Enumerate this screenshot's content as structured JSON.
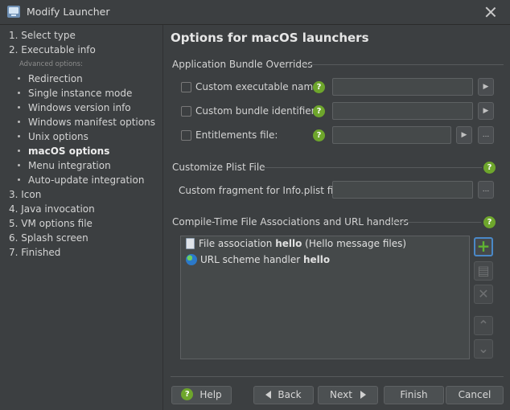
{
  "window": {
    "title": "Modify Launcher",
    "app_icon": "monitor-icon",
    "close_icon": "close-icon"
  },
  "sidebar": {
    "steps": [
      {
        "label": "1. Select type"
      },
      {
        "label": "2. Executable info"
      },
      {
        "label": "3. Icon"
      },
      {
        "label": "4. Java invocation"
      },
      {
        "label": "5. VM options file"
      },
      {
        "label": "6. Splash screen"
      },
      {
        "label": "7. Finished"
      }
    ],
    "advanced_label": "Advanced options:",
    "sub_steps": [
      {
        "label": "Redirection"
      },
      {
        "label": "Single instance mode"
      },
      {
        "label": "Windows version info"
      },
      {
        "label": "Windows manifest options"
      },
      {
        "label": "Unix options"
      },
      {
        "label": "macOS options",
        "active": true
      },
      {
        "label": "Menu integration"
      },
      {
        "label": "Auto-update integration"
      }
    ]
  },
  "main": {
    "page_title": "Options for macOS launchers",
    "bundle_overrides": {
      "title": "Application Bundle Overrides",
      "fields": [
        {
          "label": "Custom executable name:",
          "value": "",
          "checked": false
        },
        {
          "label": "Custom bundle identifier:",
          "value": "",
          "checked": false
        },
        {
          "label": "Entitlements file:",
          "value": "",
          "checked": false
        }
      ]
    },
    "plist": {
      "title": "Customize Plist File",
      "label": "Custom fragment for Info.plist file:",
      "value": "",
      "browse_label": "..."
    },
    "associations": {
      "title": "Compile-Time File Associations and URL handlers",
      "items": [
        {
          "icon": "file-icon",
          "prefix": "File association ",
          "bold": "hello",
          "suffix": " (Hello message files)"
        },
        {
          "icon": "globe-icon",
          "prefix": "URL scheme handler ",
          "bold": "hello",
          "suffix": ""
        }
      ],
      "tools": [
        "add-icon",
        "edit-icon",
        "delete-icon",
        "move-up-icon",
        "move-down-icon"
      ]
    },
    "help_glyph": "?",
    "browse_glyph": "...",
    "arrow_glyph": "▶"
  },
  "footer": {
    "help": "Help",
    "back": "Back",
    "next": "Next",
    "finish": "Finish",
    "cancel": "Cancel"
  },
  "colors": {
    "background": "#3c3f41",
    "help_icon_green": "#6ea62c",
    "add_button_border": "#4a88c7"
  }
}
